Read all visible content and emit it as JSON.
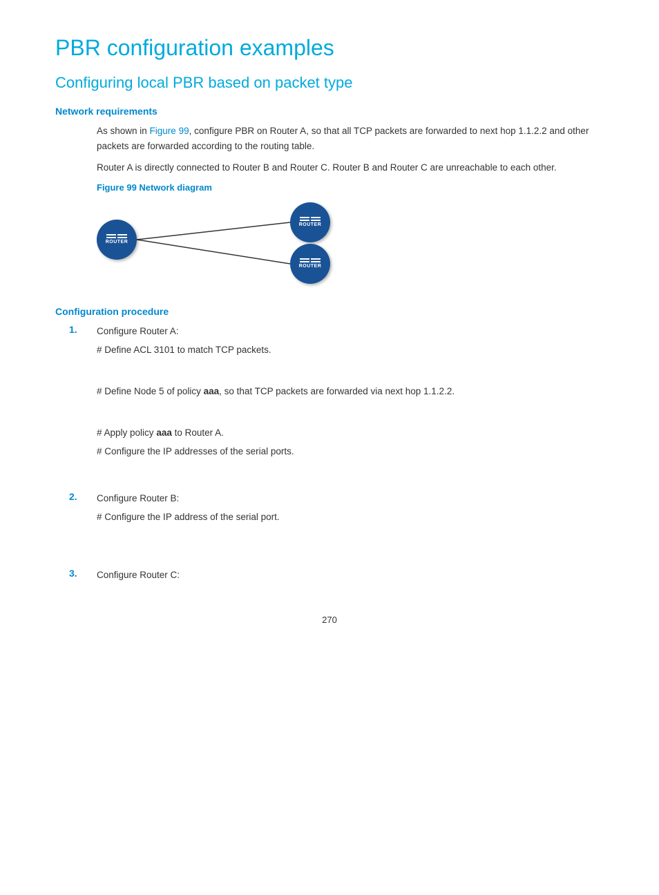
{
  "page": {
    "title": "PBR configuration examples",
    "subtitle": "Configuring local PBR based on packet type",
    "network_requirements_heading": "Network requirements",
    "network_req_para1_prefix": "As shown in ",
    "network_req_para1_link": "Figure 99",
    "network_req_para1_suffix": ", configure PBR on Router A, so that all TCP packets are forwarded to next hop 1.1.2.2 and other packets are forwarded according to the routing table.",
    "network_req_para2": "Router A is directly connected to Router B and Router C. Router B and Router C are unreachable to each other.",
    "figure_caption": "Figure 99 Network diagram",
    "config_procedure_heading": "Configuration procedure",
    "steps": [
      {
        "number": "1.",
        "title": "Configure Router A:",
        "sub_steps": [
          "# Define ACL 3101 to match TCP packets.",
          "# Define Node 5 of policy aaa, so that TCP packets are forwarded via next hop 1.1.2.2.",
          "# Apply policy aaa to Router A.",
          "# Configure the IP addresses of the serial ports."
        ]
      },
      {
        "number": "2.",
        "title": "Configure Router B:",
        "sub_steps": [
          "# Configure the IP address of the serial port."
        ]
      },
      {
        "number": "3.",
        "title": "Configure Router C:",
        "sub_steps": []
      }
    ],
    "page_number": "270"
  }
}
